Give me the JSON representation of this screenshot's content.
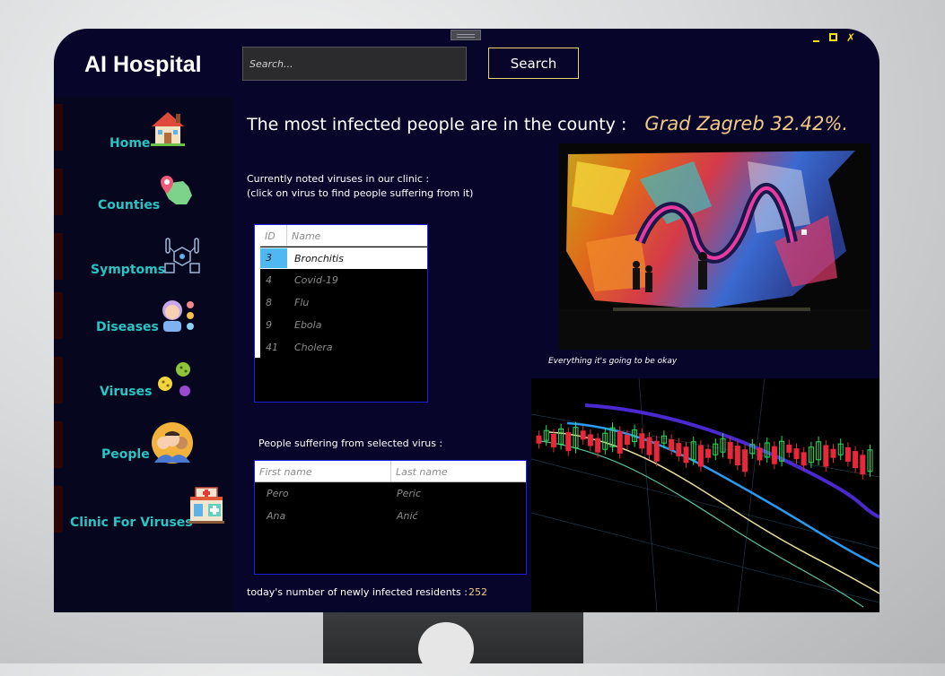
{
  "app": {
    "title": "AI Hospital",
    "window_controls": [
      "_",
      "□",
      "✗"
    ]
  },
  "search": {
    "placeholder": "Search...",
    "button_label": "Search"
  },
  "sidebar": {
    "items": [
      {
        "label": "Home",
        "icon": "house-icon"
      },
      {
        "label": "Counties",
        "icon": "map-pin-icon"
      },
      {
        "label": "Symptoms",
        "icon": "symptoms-icon"
      },
      {
        "label": "Diseases",
        "icon": "sick-person-icon"
      },
      {
        "label": "Viruses",
        "icon": "virus-icon"
      },
      {
        "label": "People",
        "icon": "people-icon"
      },
      {
        "label": "Clinic For Viruses",
        "icon": "clinic-icon"
      }
    ]
  },
  "headline": {
    "text": "The most infected people are in the county :",
    "county": "Grad Zagreb 32.42%."
  },
  "clinic_note": {
    "line1": "Currently noted viruses in our clinic :",
    "line2": "(click on virus to find people suffering from it)"
  },
  "virus_table": {
    "columns": [
      "ID",
      "Name"
    ],
    "rows": [
      {
        "id": "3",
        "name": "Bronchitis",
        "selected": true
      },
      {
        "id": "4",
        "name": "Covid-19"
      },
      {
        "id": "8",
        "name": "Flu"
      },
      {
        "id": "9",
        "name": "Ebola"
      },
      {
        "id": "41",
        "name": "Cholera"
      }
    ]
  },
  "people_section": {
    "label": "People suffering from selected virus :",
    "columns": [
      "First name",
      "Last name"
    ],
    "rows": [
      {
        "first": "Pero",
        "last": "Peric"
      },
      {
        "first": "Ana",
        "last": "Anić"
      }
    ]
  },
  "new_infected": {
    "label": "today's number of newly infected residents :",
    "value": "252"
  },
  "photo": {
    "caption": "Everything it's going to be okay"
  },
  "colors": {
    "window_bg": "#07062a",
    "nav_text": "#2bc4c4",
    "accent_gold": "#f3c98a",
    "search_border": "#e8d46a",
    "grid_border": "#1f1fe0",
    "selection": "#50b8f0",
    "window_controls": "#f5e400"
  }
}
